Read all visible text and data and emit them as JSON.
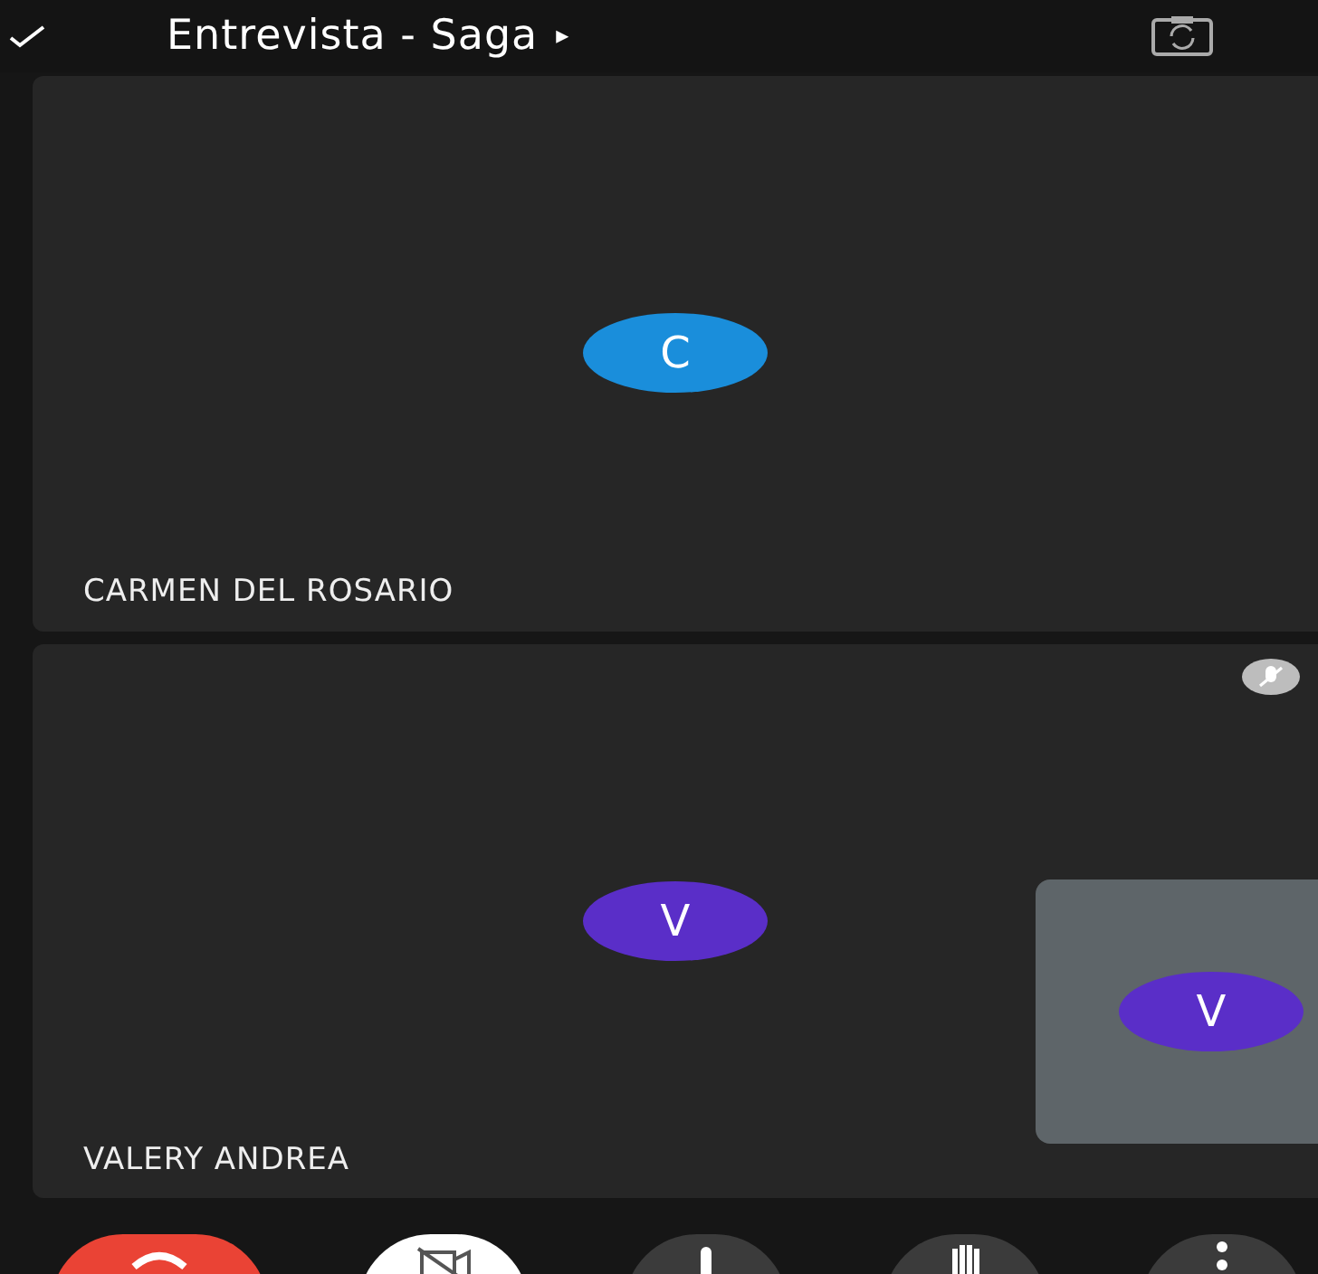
{
  "header": {
    "title": "Entrevista - Saga",
    "expand_arrow": "▸"
  },
  "participants": [
    {
      "name": "CARMEN DEL ROSARIO",
      "initial": "C",
      "color": "#1a8edb",
      "muted": false
    },
    {
      "name": "VALERY ANDREA",
      "initial": "V",
      "color": "#5a2ec8",
      "muted": true
    }
  ],
  "self_view": {
    "initial": "V",
    "color": "#5a2ec8"
  },
  "controls": [
    {
      "kind": "end-call"
    },
    {
      "kind": "camera-off"
    },
    {
      "kind": "mic"
    },
    {
      "kind": "hand"
    },
    {
      "kind": "more"
    }
  ]
}
